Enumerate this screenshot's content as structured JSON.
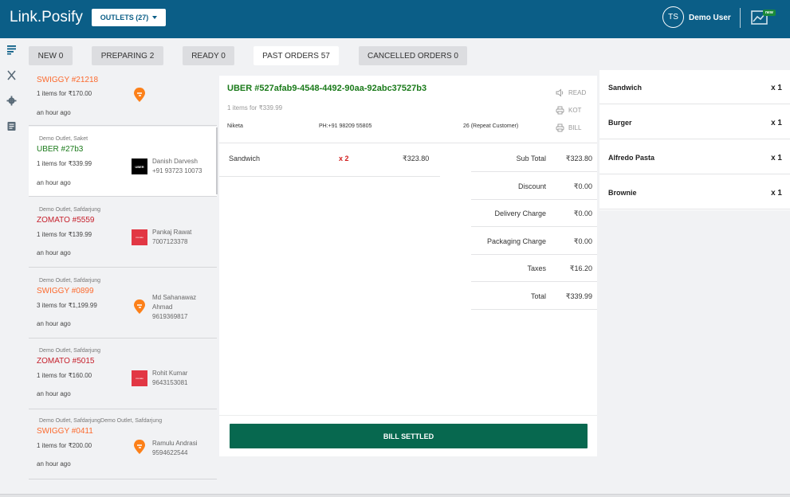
{
  "header": {
    "brand": "Link.Posify",
    "outlets_label": "OUTLETS (27)",
    "avatar_initials": "TS",
    "user_name": "Demo User",
    "new_badge": "new"
  },
  "tabs": [
    {
      "label": "NEW 0"
    },
    {
      "label": "PREPARING 2"
    },
    {
      "label": "READY 0"
    },
    {
      "label": "PAST ORDERS 57"
    },
    {
      "label": "CANCELLED ORDERS 0"
    }
  ],
  "orders": [
    {
      "outlet": "",
      "title": "SWIGGY #21218",
      "items": "1 items for ₹170.00",
      "time": "an hour ago",
      "customer_name": "",
      "customer_phone": "",
      "logo": "swiggy-logo"
    },
    {
      "outlet": "Demo Outlet, Saket",
      "title": "UBER #27b3",
      "items": "1 items for ₹339.99",
      "time": "an hour ago",
      "customer_name": "Danish Darvesh",
      "customer_phone": "+91 93723 10073",
      "logo": "uber-logo",
      "logo_text": "UBER"
    },
    {
      "outlet": "Demo Outlet, Safdarjung",
      "title": "ZOMATO #5559",
      "items": "1 items for ₹139.99",
      "time": "an hour ago",
      "customer_name": "Pankaj Rawat",
      "customer_phone": "7007123378",
      "logo": "zomato-logo",
      "logo_text": "zomato"
    },
    {
      "outlet": "Demo Outlet, Safdarjung",
      "title": "SWIGGY #0899",
      "items": "3 items for ₹1,199.99",
      "time": "an hour ago",
      "customer_name": "Md Sahanawaz Ahmad",
      "customer_phone": "9619369817",
      "logo": "swiggy-logo"
    },
    {
      "outlet": "Demo Outlet, Safdarjung",
      "title": "ZOMATO #5015",
      "items": "1 items for ₹160.00",
      "time": "an hour ago",
      "customer_name": "Rohit Kumar",
      "customer_phone": "9643153081",
      "logo": "zomato-logo",
      "logo_text": "zomato"
    },
    {
      "outlet": "Demo Outlet, SafdarjungDemo Outlet, Safdarjung",
      "title": "SWIGGY #0411",
      "items": "1 items for ₹200.00",
      "time": "an hour ago",
      "customer_name": "Ramulu Andrasi",
      "customer_phone": "9594622544",
      "logo": "swiggy-logo"
    }
  ],
  "detail": {
    "title": "UBER #527afab9-4548-4492-90aa-92abc37527b3",
    "items_summary": "1 items for ₹339.99",
    "customer_name": "Niketa",
    "phone": "PH:+91 98209 55805",
    "repeat_note": "26 (Repeat Customer)",
    "actions": {
      "read": "READ",
      "kot": "KOT",
      "bill": "BILL"
    },
    "line_item": {
      "name": "Sandwich",
      "qty": "x 2",
      "price": "₹323.80"
    },
    "totals": [
      {
        "label": "Sub Total",
        "value": "₹323.80"
      },
      {
        "label": "Discount",
        "value": "₹0.00"
      },
      {
        "label": "Delivery Charge",
        "value": "₹0.00"
      },
      {
        "label": "Packaging Charge",
        "value": "₹0.00"
      },
      {
        "label": "Taxes",
        "value": "₹16.20"
      },
      {
        "label": "Total",
        "value": "₹339.99"
      }
    ],
    "settle_label": "BILL SETTLED"
  },
  "summary_items": [
    {
      "name": "Sandwich",
      "qty": "x 1"
    },
    {
      "name": "Burger",
      "qty": "x 1"
    },
    {
      "name": "Alfredo Pasta",
      "qty": "x 1"
    },
    {
      "name": "Brownie",
      "qty": "x 1"
    }
  ],
  "colors": {
    "header": "#0b5e87",
    "swiggy": "#fc6a2e",
    "uber": "#1a7a1a",
    "zomato": "#c6202c",
    "settle_button": "#07684f"
  }
}
